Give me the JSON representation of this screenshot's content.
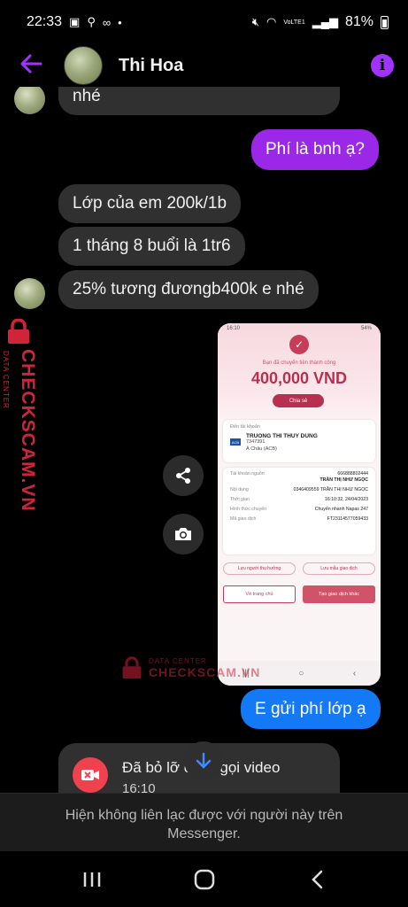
{
  "status_bar": {
    "time": "22:33",
    "network": "VoLTE1",
    "battery": "81%"
  },
  "header": {
    "contact_name": "Thi Hoa"
  },
  "messages": [
    {
      "side": "in",
      "text": "nhé"
    },
    {
      "side": "out",
      "text": "Phí là bnh ạ?"
    },
    {
      "side": "in",
      "text": "Lớp của em 200k/1b"
    },
    {
      "side": "in",
      "text": "1 tháng 8 buổi là 1tr6"
    },
    {
      "side": "in",
      "text": "25% tương đươngb400k e nhé"
    },
    {
      "side": "out",
      "text": "E gửi phí lớp ạ"
    }
  ],
  "transfer_screenshot": {
    "status_time": "16:10",
    "status_battery": "54%",
    "success_text": "Bạn đã chuyển tiền thành công",
    "amount": "400,000 VND",
    "share_label": "Chia sẻ",
    "to_account_label": "Đến tài khoản",
    "recipient_name": "TRUONG THI THUY DUNG",
    "recipient_account": "7347391",
    "bank_logo": "ACB",
    "bank_name": "Á Châu (ACB)",
    "rows": [
      {
        "k": "Tài khoản nguồn",
        "v": "666888802444"
      },
      {
        "k": "",
        "v": "TRẦN THỊ NHƯ NGỌC"
      },
      {
        "k": "Nội dung",
        "v": "0346409559 TRẦN THỊ NHƯ NGỌC"
      },
      {
        "k": "Thời gian",
        "v": "16:10:32, 24/04/2023"
      },
      {
        "k": "Hình thức chuyển",
        "v": "Chuyển nhanh Napas 247"
      },
      {
        "k": "Mã giao dịch",
        "v": "FT23114577059433"
      }
    ],
    "link_save_recipient": "Lưu người thụ hưởng",
    "link_save_template": "Lưu mẫu giao dịch",
    "btn_home": "Về trang chủ",
    "btn_new": "Tạo giao dịch khác"
  },
  "watermark": {
    "brand": "CHECKSCAM.VN",
    "sub": "DATA CENTER"
  },
  "missed_call": {
    "title": "Đã bỏ lỡ cuộc gọi video",
    "time": "16:10"
  },
  "footer": {
    "notice": "Hiện không liên lạc được với người này trên Messenger."
  },
  "colors": {
    "accent_purple": "#a033ff",
    "outgoing_purple": "#9b27e8",
    "outgoing_blue": "#1479f5",
    "missed_call_red": "#f0414e",
    "watermark_red": "#d1243b"
  }
}
